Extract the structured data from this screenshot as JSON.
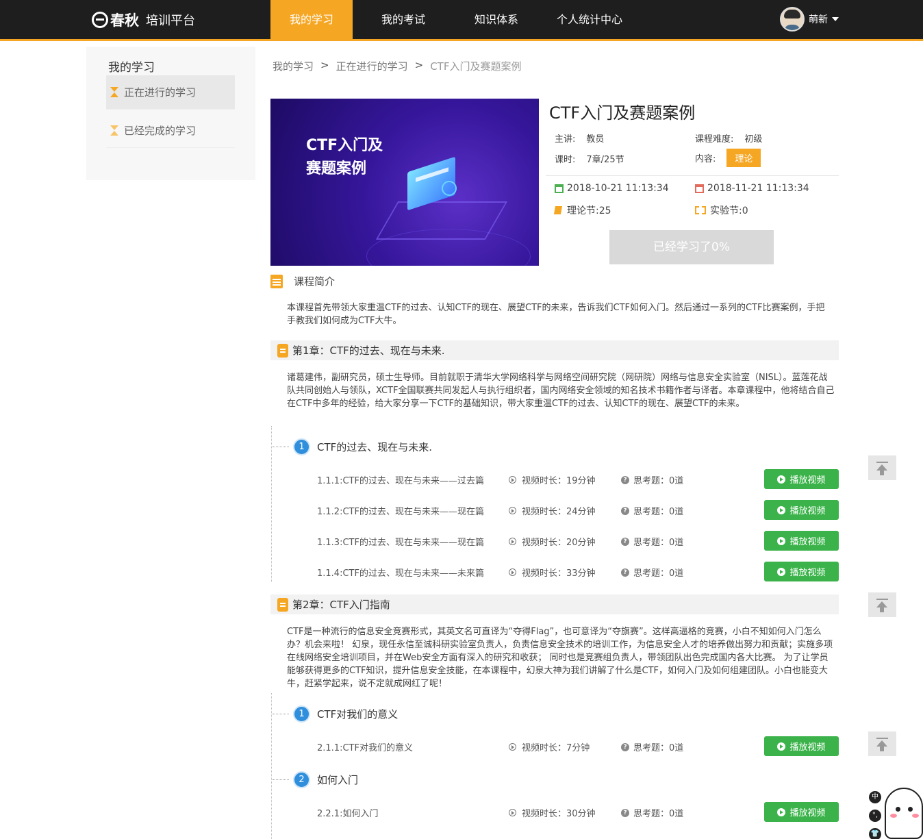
{
  "header": {
    "brand": "春秋",
    "subtitle": "培训平台",
    "nav": [
      {
        "label": "我的学习",
        "active": true
      },
      {
        "label": "我的考试",
        "active": false
      },
      {
        "label": "知识体系",
        "active": false
      },
      {
        "label": "个人统计中心",
        "active": false
      }
    ],
    "user_name": "萌新"
  },
  "sidebar": {
    "title": "我的学习",
    "items": [
      {
        "label": "正在进行的学习",
        "active": true
      },
      {
        "label": "已经完成的学习",
        "active": false
      }
    ]
  },
  "breadcrumb": [
    "我的学习",
    "正在进行的学习",
    "CTF入门及赛题案例"
  ],
  "breadcrumb_sep": ">",
  "course": {
    "banner_line1": "CTF入门及",
    "banner_line2": "赛题案例",
    "title": "CTF入门及赛题案例",
    "lecturer_label": "主讲:",
    "lecturer": "教员",
    "difficulty_label": "课程难度:",
    "difficulty": "初级",
    "hours_label": "课时:",
    "hours": "7章/25节",
    "content_label": "内容:",
    "content_tag": "理论",
    "start_date": "2018-10-21 11:13:34",
    "end_date": "2018-11-21 11:13:34",
    "theory": "理论节:25",
    "lab": "实验节:0",
    "progress_label": "已经学习了0%"
  },
  "intro": {
    "heading": "课程简介",
    "text": "本课程首先带领大家重温CTF的过去、认知CTF的现在、展望CTF的未来，告诉我们CTF如何入门。然后通过一系列的CTF比赛案例，手把手教我们如何成为CTF大牛。"
  },
  "chapters": [
    {
      "title": "第1章：CTF的过去、现在与未来.",
      "desc": "诸葛建伟，副研究员，硕士生导师。目前就职于清华大学网络科学与网络空间研究院（网研院）网络与信息安全实验室（NISL）。蓝莲花战队共同创始人与领队，XCTF全国联赛共同发起人与执行组织者，国内网络安全领域的知名技术书籍作者与译者。本章课程中，他将结合自己在CTF中多年的经验，给大家分享一下CTF的基础知识，带大家重温CTF的过去、认知CTF的现在、展望CTF的未来。",
      "sections": [
        {
          "num": "1",
          "title": "CTF的过去、现在与未来.",
          "lessons": [
            {
              "name": "1.1.1:CTF的过去、现在与未来——过去篇",
              "duration": "视频时长：19分钟",
              "think": "思考题：0道"
            },
            {
              "name": "1.1.2:CTF的过去、现在与未来——现在篇",
              "duration": "视频时长：24分钟",
              "think": "思考题：0道"
            },
            {
              "name": "1.1.3:CTF的过去、现在与未来——现在篇",
              "duration": "视频时长：20分钟",
              "think": "思考题：0道"
            },
            {
              "name": "1.1.4:CTF的过去、现在与未来——未来篇",
              "duration": "视频时长：33分钟",
              "think": "思考题：0道"
            }
          ]
        }
      ]
    },
    {
      "title": "第2章：CTF入门指南",
      "desc": "CTF是一种流行的信息安全竞赛形式，其英文名可直译为“夺得Flag”，也可意译为“夺旗赛”。这样高逼格的竞赛，小白不知如何入门怎么办？机会来啦！ 幻泉，现任永信至诚科研实验室负责人，负责信息安全技术的培训工作，为信息安全人才的培养做出努力和贡献；实施多项在线网络安全培训项目，并在Web安全方面有深入的研究和收获； 同时也是竞赛组负责人，带领团队出色完成国内各大比赛。 为了让学员能够获得更多的CTF知识，提升信息安全技能，在本课程中，幻泉大神为我们讲解了什么是CTF，如何入门及如何组建团队。小白也能变大牛，赶紧学起来，说不定就成网红了呢！",
      "sections": [
        {
          "num": "1",
          "title": "CTF对我们的意义",
          "lessons": [
            {
              "name": "2.1.1:CTF对我们的意义",
              "duration": "视频时长：7分钟",
              "think": "思考题：0道"
            }
          ]
        },
        {
          "num": "2",
          "title": "如何入门",
          "lessons": [
            {
              "name": "2.2.1:如何入门",
              "duration": "视频时长：30分钟",
              "think": "思考题：0道"
            }
          ]
        }
      ]
    }
  ],
  "play_label": "播放视频",
  "tools": [
    "中",
    "°,",
    "👕"
  ],
  "colors": {
    "accent": "#f5a623",
    "play_green": "#3bb34a",
    "section_blue": "#2f8fdc",
    "topbar": "#1e1e1e"
  }
}
